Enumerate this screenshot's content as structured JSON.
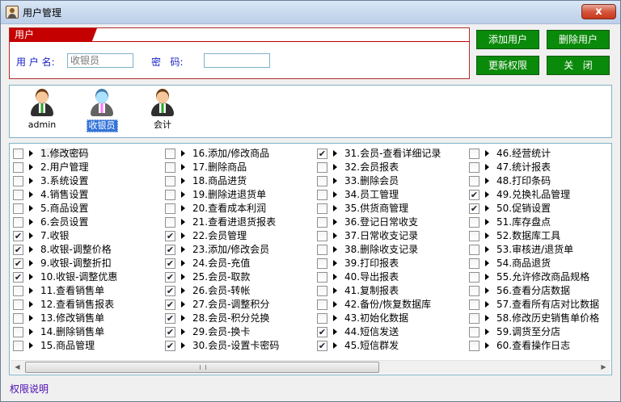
{
  "window": {
    "title": "用户管理",
    "close_label": "x"
  },
  "user_panel": {
    "tab_label": "用户",
    "username_label": "用 户 名:",
    "username_value": "收银员",
    "password_label": "密   码:",
    "password_value": ""
  },
  "buttons": {
    "add_user": "添加用户",
    "delete_user": "删除用户",
    "update_permissions": "更新权限",
    "close": "关   闭"
  },
  "roles": [
    {
      "name": "admin",
      "selected": false
    },
    {
      "name": "收银员",
      "selected": true
    },
    {
      "name": "会计",
      "selected": false
    }
  ],
  "permissions": [
    {
      "label": "1.修改密码",
      "checked": false
    },
    {
      "label": "2.用户管理",
      "checked": false
    },
    {
      "label": "3.系统设置",
      "checked": false
    },
    {
      "label": "4.销售设置",
      "checked": false
    },
    {
      "label": "5.商品设置",
      "checked": false
    },
    {
      "label": "6.会员设置",
      "checked": false
    },
    {
      "label": "7.收银",
      "checked": true
    },
    {
      "label": "8.收银-调整价格",
      "checked": true
    },
    {
      "label": "9.收银-调整折扣",
      "checked": true
    },
    {
      "label": "10.收银-调整优惠",
      "checked": true
    },
    {
      "label": "11.查看销售单",
      "checked": false
    },
    {
      "label": "12.查看销售报表",
      "checked": false
    },
    {
      "label": "13.修改销售单",
      "checked": false
    },
    {
      "label": "14.删除销售单",
      "checked": false
    },
    {
      "label": "15.商品管理",
      "checked": false
    },
    {
      "label": "16.添加/修改商品",
      "checked": false
    },
    {
      "label": "17.删除商品",
      "checked": false
    },
    {
      "label": "18.商品进货",
      "checked": false
    },
    {
      "label": "19.删除进退货单",
      "checked": false
    },
    {
      "label": "20.查看成本利润",
      "checked": false
    },
    {
      "label": "21.查看进退货报表",
      "checked": false
    },
    {
      "label": "22.会员管理",
      "checked": true
    },
    {
      "label": "23.添加/修改会员",
      "checked": true
    },
    {
      "label": "24.会员-充值",
      "checked": true
    },
    {
      "label": "25.会员-取款",
      "checked": true
    },
    {
      "label": "26.会员-转帐",
      "checked": true
    },
    {
      "label": "27.会员-调整积分",
      "checked": true
    },
    {
      "label": "28.会员-积分兑换",
      "checked": true
    },
    {
      "label": "29.会员-换卡",
      "checked": true
    },
    {
      "label": "30.会员-设置卡密码",
      "checked": true
    },
    {
      "label": "31.会员-查看详细记录",
      "checked": true
    },
    {
      "label": "32.会员报表",
      "checked": false
    },
    {
      "label": "33.删除会员",
      "checked": false
    },
    {
      "label": "34.员工管理",
      "checked": false
    },
    {
      "label": "35.供货商管理",
      "checked": false
    },
    {
      "label": "36.登记日常收支",
      "checked": false
    },
    {
      "label": "37.日常收支记录",
      "checked": false
    },
    {
      "label": "38.删除收支记录",
      "checked": false
    },
    {
      "label": "39.打印报表",
      "checked": false
    },
    {
      "label": "40.导出报表",
      "checked": false
    },
    {
      "label": "41.复制报表",
      "checked": false
    },
    {
      "label": "42.备份/恢复数据库",
      "checked": false
    },
    {
      "label": "43.初始化数据",
      "checked": false
    },
    {
      "label": "44.短信发送",
      "checked": true
    },
    {
      "label": "45.短信群发",
      "checked": true
    },
    {
      "label": "46.经营统计",
      "checked": false
    },
    {
      "label": "47.统计报表",
      "checked": false
    },
    {
      "label": "48.打印条码",
      "checked": false
    },
    {
      "label": "49.兑换礼品管理",
      "checked": true
    },
    {
      "label": "50.促销设置",
      "checked": true
    },
    {
      "label": "51.库存盘点",
      "checked": false
    },
    {
      "label": "52.数据库工具",
      "checked": false
    },
    {
      "label": "53.审核进/退货单",
      "checked": false
    },
    {
      "label": "54.商品退货",
      "checked": false
    },
    {
      "label": "55.允许修改商品规格",
      "checked": false
    },
    {
      "label": "56.查看分店数据",
      "checked": false
    },
    {
      "label": "57.查看所有店对比数据",
      "checked": false
    },
    {
      "label": "58.修改历史销售单价格",
      "checked": false
    },
    {
      "label": "59.调货至分店",
      "checked": false
    },
    {
      "label": "60.查看操作日志",
      "checked": false
    }
  ],
  "scrollbar": {
    "left_arrow": "◀",
    "right_arrow": "▶"
  },
  "footer": {
    "help_link": "权限说明"
  }
}
